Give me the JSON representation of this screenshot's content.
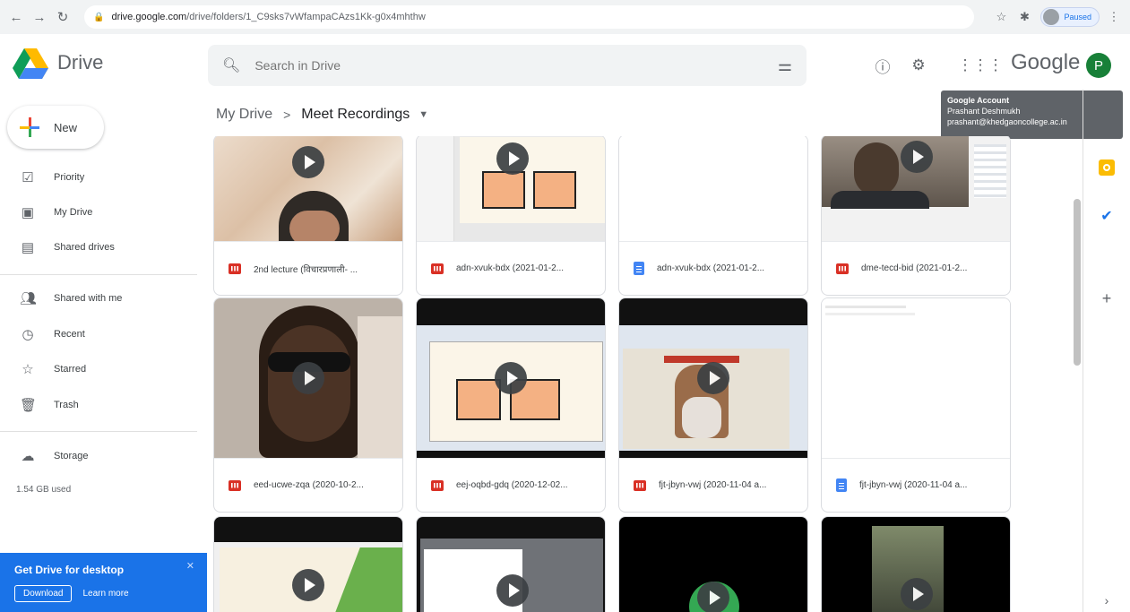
{
  "browser": {
    "url_host": "drive.google.com",
    "url_path": "/drive/folders/1_C9sks7vWfampaCAzs1Kk-g0x4mhthw",
    "profile_label": "Paused"
  },
  "app": {
    "name": "Drive",
    "brand_word": "Google",
    "avatar_letter": "P"
  },
  "search": {
    "placeholder": "Search in Drive"
  },
  "account_tooltip": {
    "title": "Google Account",
    "name": "Prashant Deshmukh",
    "email": "prashant@khedgaoncollege.ac.in"
  },
  "sidebar": {
    "new_label": "New",
    "items": [
      {
        "label": "Priority",
        "icon": "check-circle-icon"
      },
      {
        "label": "My Drive",
        "icon": "drive-icon"
      },
      {
        "label": "Shared drives",
        "icon": "shared-drives-icon"
      },
      {
        "label": "Shared with me",
        "icon": "people-icon"
      },
      {
        "label": "Recent",
        "icon": "clock-icon"
      },
      {
        "label": "Starred",
        "icon": "star-icon"
      },
      {
        "label": "Trash",
        "icon": "trash-icon"
      },
      {
        "label": "Storage",
        "icon": "cloud-icon"
      }
    ],
    "storage_used": "1.54 GB used"
  },
  "promo": {
    "title": "Get Drive for desktop",
    "download_label": "Download",
    "learn_more_label": "Learn more"
  },
  "breadcrumb": {
    "root": "My Drive",
    "separator": ">",
    "current": "Meet Recordings"
  },
  "files": [
    {
      "name": "2nd lecture (विचारप्रणाली- ...",
      "type": "video"
    },
    {
      "name": "adn-xvuk-bdx (2021-01-2...",
      "type": "video"
    },
    {
      "name": "adn-xvuk-bdx (2021-01-2...",
      "type": "doc"
    },
    {
      "name": "dme-tecd-bid (2021-01-2...",
      "type": "video"
    },
    {
      "name": "eed-ucwe-zqa (2020-10-2...",
      "type": "video"
    },
    {
      "name": "eej-oqbd-gdq (2020-12-02...",
      "type": "video"
    },
    {
      "name": "fjt-jbyn-vwj (2020-11-04 a...",
      "type": "video"
    },
    {
      "name": "fjt-jbyn-vwj (2020-11-04 a...",
      "type": "doc"
    },
    {
      "name": "",
      "type": "video"
    },
    {
      "name": "",
      "type": "video"
    },
    {
      "name": "",
      "type": "video"
    },
    {
      "name": "",
      "type": "video"
    }
  ],
  "colors": {
    "accent": "#1a73e8",
    "video_icon": "#d93025",
    "doc_icon": "#4285f4",
    "avatar": "#188038"
  }
}
